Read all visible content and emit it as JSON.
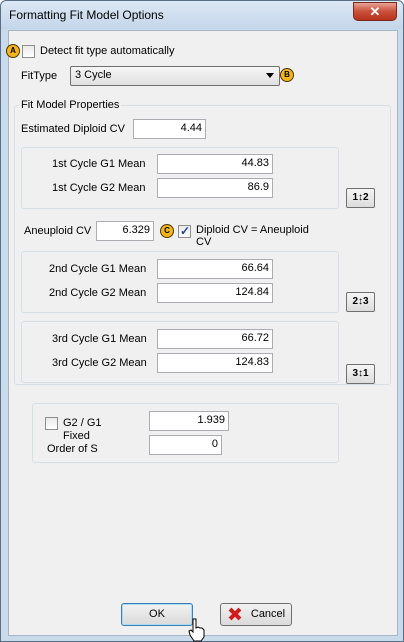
{
  "window": {
    "title": "Formatting Fit Model Options",
    "close_glyph": "✕"
  },
  "markers": {
    "a": "A",
    "b": "B",
    "c": "C"
  },
  "detect_fit": {
    "label": "Detect fit type automatically",
    "checked": false
  },
  "fit_type": {
    "label": "FitType",
    "value": "3 Cycle"
  },
  "fit_model_properties": {
    "legend": "Fit Model Properties",
    "estimated_diploid_cv": {
      "label": "Estimated Diploid CV",
      "value": "4.44"
    }
  },
  "cycle1": {
    "g1_label": "1st Cycle G1 Mean",
    "g1_value": "44.83",
    "g2_label": "1st Cycle G2 Mean",
    "g2_value": "86.9",
    "swap_label": "1↕2"
  },
  "aneuploid": {
    "label": "Aneuploid CV",
    "value": "6.329",
    "diploid_equals_label": "Diploid CV = Aneuploid CV",
    "diploid_equals_checked": true
  },
  "cycle2": {
    "g1_label": "2nd Cycle G1 Mean",
    "g1_value": "66.64",
    "g2_label": "2nd Cycle G2 Mean",
    "g2_value": "124.84",
    "swap_label": "2↕3"
  },
  "cycle3": {
    "g1_label": "3rd Cycle G1 Mean",
    "g1_value": "66.72",
    "g2_label": "3rd Cycle G2 Mean",
    "g2_value": "124.83",
    "swap_label": "3↕1"
  },
  "extra": {
    "g2g1_label": "G2 / G1",
    "g2g1_value": "1.939",
    "fixed_checked": false,
    "fixed_label": "Fixed",
    "order_label": "Order of S",
    "order_value": "0"
  },
  "buttons": {
    "ok": "OK",
    "cancel": "Cancel"
  }
}
